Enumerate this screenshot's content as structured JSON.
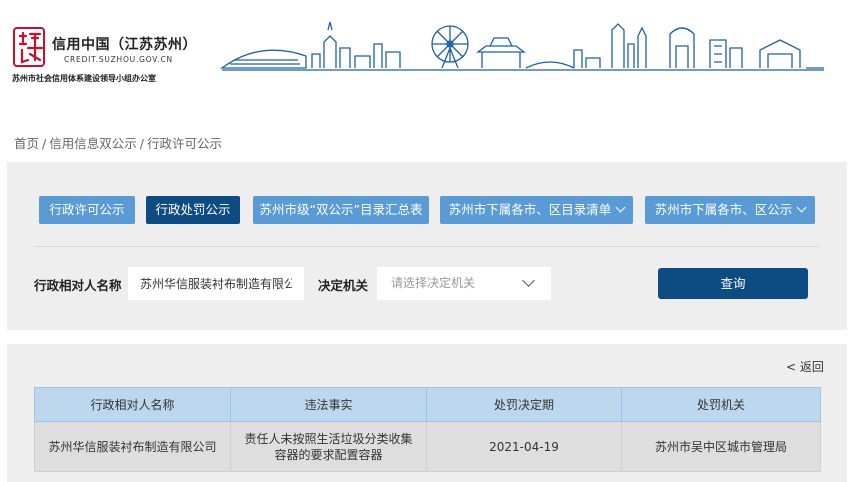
{
  "header": {
    "logo_title": "信用中国（江苏苏州）",
    "logo_url": "CREDIT.SUZHOU.GOV.CN",
    "logo_org": "苏州市社会信用体系建设领导小组办公室",
    "logo_glyph": "诚信"
  },
  "breadcrumb": {
    "items": [
      "首页",
      "信用信息双公示",
      "行政许可公示"
    ],
    "separator": "/"
  },
  "tabs": [
    {
      "label": "行政许可公示",
      "active": false,
      "dropdown": false
    },
    {
      "label": "行政处罚公示",
      "active": true,
      "dropdown": false
    },
    {
      "label": "苏州市级“双公示”目录汇总表",
      "active": false,
      "dropdown": false
    },
    {
      "label": "苏州市下属各市、区目录清单",
      "active": false,
      "dropdown": true
    },
    {
      "label": "苏州市下属各市、区公示",
      "active": false,
      "dropdown": true
    }
  ],
  "search": {
    "party_label": "行政相对人名称",
    "party_value": "苏州华信服装衬布制造有限公司",
    "authority_label": "决定机关",
    "authority_placeholder": "请选择决定机关",
    "query_label": "查询"
  },
  "results": {
    "back_label": "< 返回",
    "columns": [
      "行政相对人名称",
      "违法事实",
      "处罚决定期",
      "处罚机关"
    ],
    "rows": [
      [
        "苏州华信服装衬布制造有限公司",
        "责任人未按照生活垃圾分类收集容器的要求配置容器",
        "2021-04-19",
        "苏州市吴中区城市管理局"
      ]
    ]
  },
  "colors": {
    "tab": "#5b9bd5",
    "tab_active": "#0d4c82",
    "query_button": "#0d4c82",
    "table_header": "#bdd7ee",
    "logo_red": "#c8102e",
    "skyline_blue": "#1f5fa8"
  }
}
